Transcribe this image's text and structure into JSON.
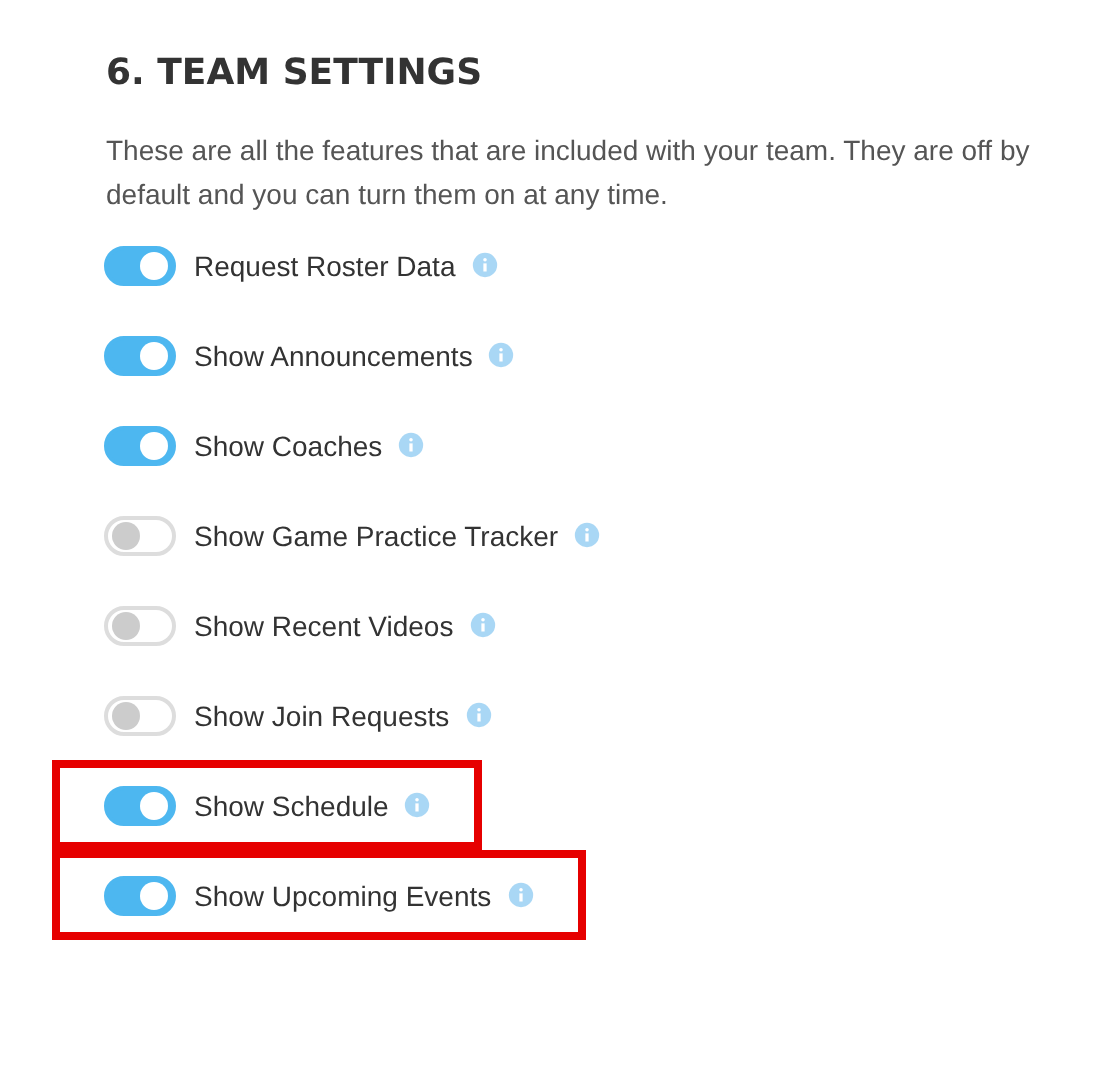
{
  "title": "6. TEAM SETTINGS",
  "description": "These are all the features that are included with your team. They are off by default and you can turn them on at any time.",
  "settings": [
    {
      "label": "Request Roster Data",
      "on": true,
      "highlighted": false
    },
    {
      "label": "Show Announcements",
      "on": true,
      "highlighted": false
    },
    {
      "label": "Show Coaches",
      "on": true,
      "highlighted": false
    },
    {
      "label": "Show Game Practice Tracker",
      "on": false,
      "highlighted": false
    },
    {
      "label": "Show Recent Videos",
      "on": false,
      "highlighted": false
    },
    {
      "label": "Show Join Requests",
      "on": false,
      "highlighted": false
    },
    {
      "label": "Show Schedule",
      "on": true,
      "highlighted": true
    },
    {
      "label": "Show Upcoming Events",
      "on": true,
      "highlighted": true
    }
  ]
}
